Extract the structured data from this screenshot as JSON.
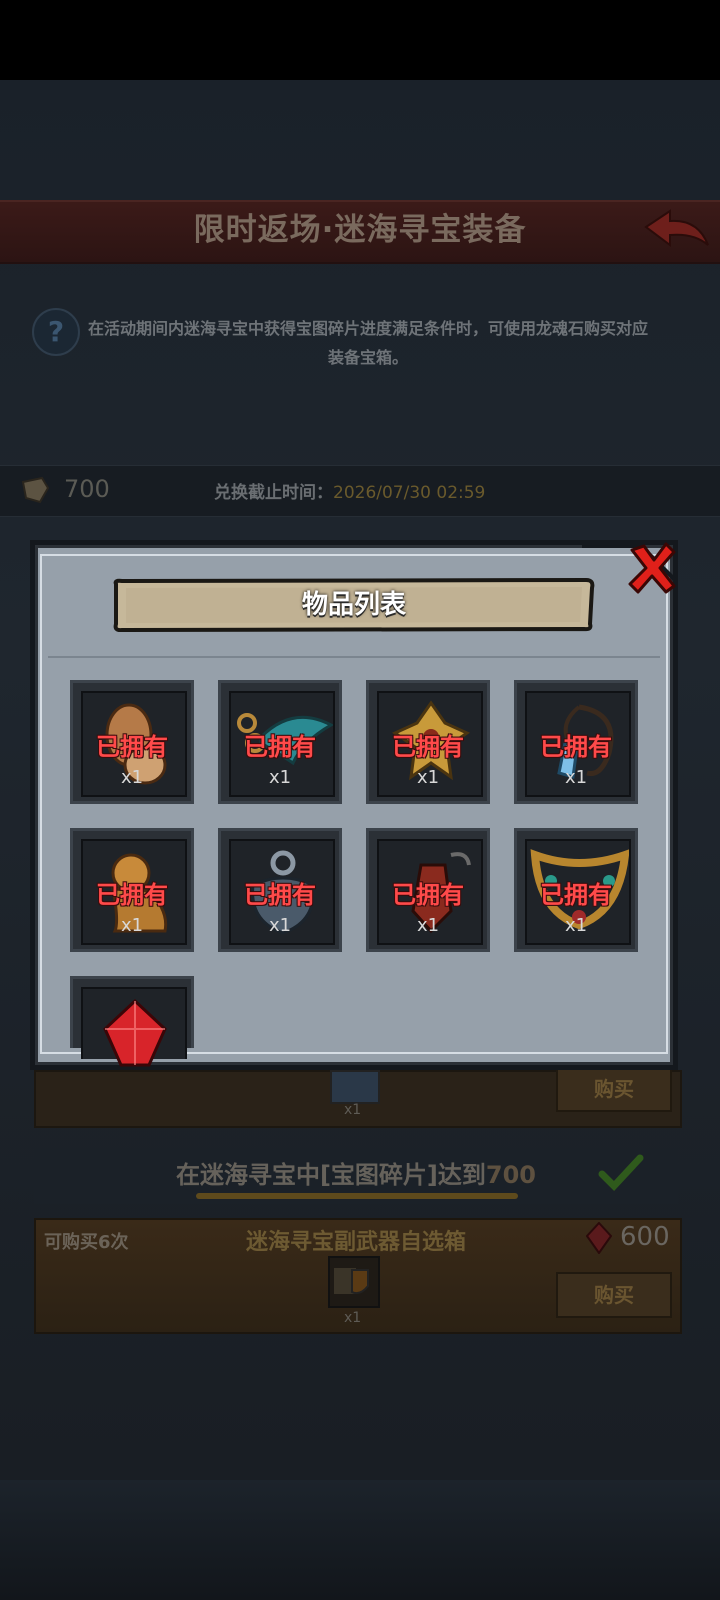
{
  "screen": {
    "title": "限时返场·迷海寻宝装备",
    "help_text": "在活动期间内迷海寻宝中获得宝图碎片进度满足条件时，可使用龙魂石购买对应装备宝箱。",
    "currency_amount": "700",
    "deadline_label": "兑换截止时间：",
    "deadline_value": "2026/07/30 02:59"
  },
  "row_partial": {
    "qty": "x1",
    "buy_label": "购买"
  },
  "condition": {
    "text": "在迷海寻宝中[宝图碎片]达到",
    "value": "700"
  },
  "offer": {
    "limit": "可购买6次",
    "name": "迷海寻宝副武器自选箱",
    "price": "600",
    "qty": "x1",
    "buy_label": "购买"
  },
  "popup": {
    "title": "物品列表",
    "items": [
      {
        "icon": "shield-item-icon",
        "status": "已拥有",
        "qty": "x1"
      },
      {
        "icon": "feather-chain-item-icon",
        "status": "已拥有",
        "qty": "x1"
      },
      {
        "icon": "golden-bird-item-icon",
        "status": "已拥有",
        "qty": "x1"
      },
      {
        "icon": "crystal-pendant-item-icon",
        "status": "已拥有",
        "qty": "x1"
      },
      {
        "icon": "lion-statue-item-icon",
        "status": "已拥有",
        "qty": "x1"
      },
      {
        "icon": "amulet-item-icon",
        "status": "已拥有",
        "qty": "x1"
      },
      {
        "icon": "lantern-item-icon",
        "status": "已拥有",
        "qty": "x1"
      },
      {
        "icon": "jeweled-necklace-item-icon",
        "status": "已拥有",
        "qty": "x1"
      },
      {
        "icon": "red-gem-item-icon"
      }
    ]
  },
  "colors": {
    "owned_text": "#ff4a4a",
    "popup_bg": "#96a0aa",
    "close_red": "#e0201a"
  }
}
